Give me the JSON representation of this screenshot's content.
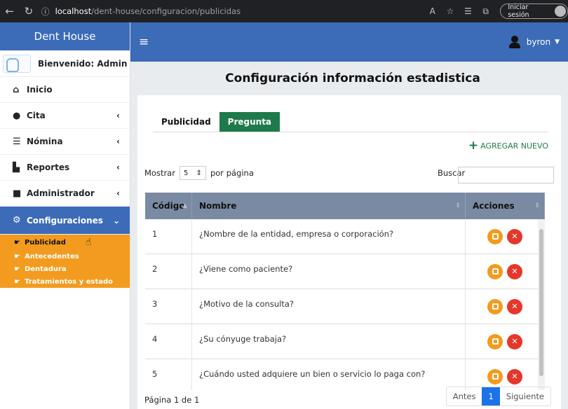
{
  "browser": {
    "url_host": "localhost",
    "url_path": "/dent-house/configuracion/publicidas",
    "signin_label": "Iniciar sesión"
  },
  "sidebar": {
    "brand": "Dent House",
    "welcome": "Bienvenido: Admin",
    "items": [
      {
        "label": "Inicio",
        "icon": "home-icon"
      },
      {
        "label": "Cita",
        "icon": "clock-icon"
      },
      {
        "label": "Nómina",
        "icon": "list-icon"
      },
      {
        "label": "Reportes",
        "icon": "file-icon"
      },
      {
        "label": "Administrador",
        "icon": "lock-icon"
      },
      {
        "label": "Configuraciones",
        "icon": "gears-icon"
      }
    ],
    "submenu": [
      "Publicidad",
      "Antecedentes",
      "Dentadura",
      "Tratamientos y estado"
    ]
  },
  "topnav": {
    "user": "byron"
  },
  "page": {
    "title": "Configuración información estadistica"
  },
  "tabs": [
    "Publicidad",
    "Pregunta"
  ],
  "add_new": "AGREGAR NUEVO",
  "controls": {
    "show_prefix": "Mostrar",
    "page_size": "5",
    "show_suffix": "por página",
    "search_label": "Buscar",
    "search_value": ""
  },
  "table": {
    "headers": [
      "Código",
      "Nombre",
      "Acciones"
    ],
    "rows": [
      {
        "code": "1",
        "name": "¿Nombre de la entidad, empresa o corporación?"
      },
      {
        "code": "2",
        "name": "¿Viene como paciente?"
      },
      {
        "code": "3",
        "name": "¿Motivo de la consulta?"
      },
      {
        "code": "4",
        "name": "¿Su cónyuge trabaja?"
      },
      {
        "code": "5",
        "name": "¿Cuándo usted adquiere un bien o servicio lo paga con?"
      }
    ]
  },
  "footer": {
    "page_info": "Página 1 de 1",
    "prev": "Antes",
    "current": "1",
    "next": "Siguiente"
  },
  "colors": {
    "primary": "#3c6bb8",
    "accent": "#f29b1e",
    "success": "#1e7a4a",
    "danger": "#e5372a"
  }
}
